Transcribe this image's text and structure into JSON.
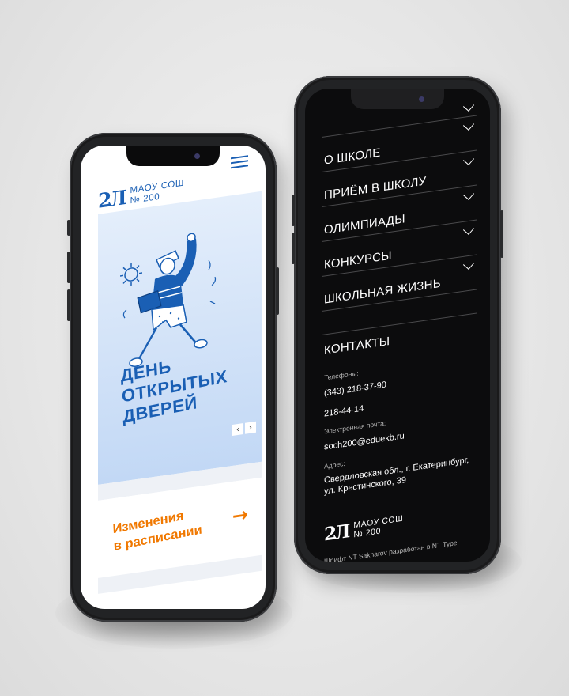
{
  "left_phone": {
    "logo": {
      "mark": "2Л",
      "line1": "МАОУ СОШ",
      "line2": "№ 200"
    },
    "menu_icon": "hamburger-icon",
    "hero": {
      "title_lines": [
        "ДЕНЬ",
        "ОТКРЫТЫХ",
        "ДВЕРЕЙ"
      ],
      "prev_label": "‹",
      "next_label": "›"
    },
    "card": {
      "line1": "Изменения",
      "line2": "в расписании",
      "arrow": "→"
    },
    "colors": {
      "brand_blue": "#1a5fb4",
      "accent_orange": "#f07800",
      "hero_bg": "#c2d8f5"
    }
  },
  "right_phone": {
    "menu": [
      {
        "label": "О ШКОЛЕ"
      },
      {
        "label": "ПРИЁМ В ШКОЛУ"
      },
      {
        "label": "ОЛИМПИАДЫ"
      },
      {
        "label": "КОНКУРСЫ"
      },
      {
        "label": "ШКОЛЬНАЯ ЖИЗНЬ"
      }
    ],
    "contacts": {
      "title": "КОНТАКТЫ",
      "phones_label": "Телефоны:",
      "phone1": "(343) 218-37-90",
      "phone2": "218-44-14",
      "email_label": "Электронная почта:",
      "email": "soch200@eduekb.ru",
      "address_label": "Адрес:",
      "address_line1": "Свердловская обл., г. Екатеринбург,",
      "address_line2": "ул. Крестинского, 39"
    },
    "logo": {
      "mark": "2Л",
      "line1": "МАОУ СОШ",
      "line2": "№ 200"
    },
    "font_credit": "Шрифт NT Sakharov разработан в NT Type",
    "colors": {
      "bg": "#0c0c0d",
      "text": "#ffffff"
    }
  }
}
